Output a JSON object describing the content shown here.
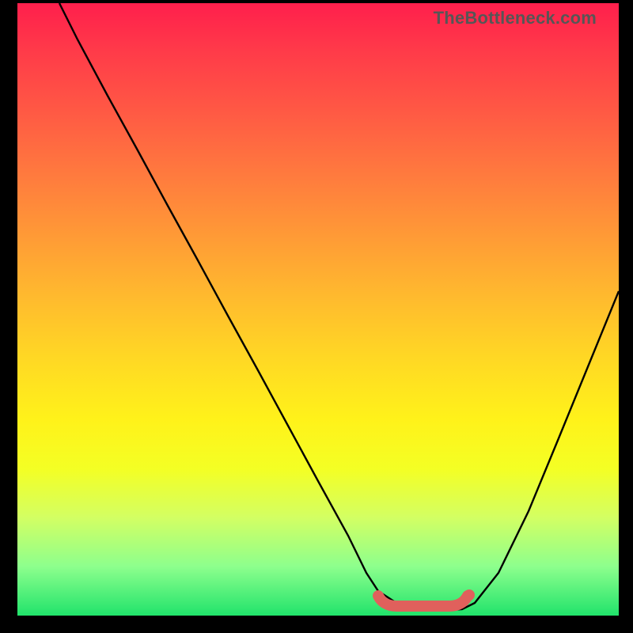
{
  "watermark": "TheBottleneck.com",
  "chart_data": {
    "type": "line",
    "title": "",
    "xlabel": "",
    "ylabel": "",
    "xlim": [
      0,
      100
    ],
    "ylim": [
      0,
      100
    ],
    "grid": false,
    "legend": false,
    "background_gradient": {
      "top": "#ff1f4c",
      "bottom": "#21e36b",
      "description": "vertical red→orange→yellow→green gradient, value 100 (red) at top, 0 (green) at bottom"
    },
    "series": [
      {
        "name": "bottleneck-curve",
        "color": "#000000",
        "x": [
          7,
          10,
          15,
          20,
          25,
          30,
          35,
          40,
          45,
          50,
          55,
          58,
          60,
          63,
          66,
          69,
          72,
          74,
          76,
          80,
          85,
          90,
          95,
          100
        ],
        "values": [
          100,
          94,
          85,
          76,
          67,
          58,
          49,
          40,
          31,
          22,
          13,
          7,
          4,
          2,
          1,
          1,
          1,
          1,
          2,
          7,
          17,
          29,
          41,
          53
        ]
      },
      {
        "name": "optimal-range-marker",
        "color": "#e0605c",
        "type": "segment",
        "x": [
          60,
          62,
          64,
          66,
          68,
          70,
          72,
          74
        ],
        "values": [
          3,
          2,
          1.5,
          1,
          1,
          1,
          1.5,
          3
        ],
        "note": "thick salmon flat-bottom marker indicating optimal range"
      }
    ]
  }
}
